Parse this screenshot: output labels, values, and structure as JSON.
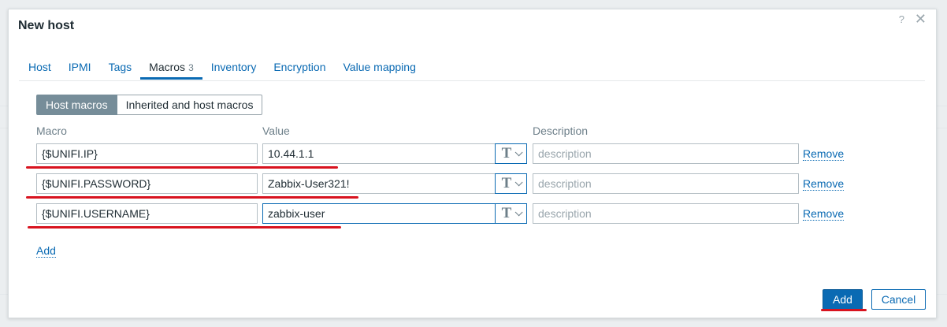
{
  "dialog": {
    "title": "New host",
    "help_icon": "?",
    "close_icon": "✕"
  },
  "tabs": [
    {
      "label": "Host"
    },
    {
      "label": "IPMI"
    },
    {
      "label": "Tags"
    },
    {
      "label": "Macros",
      "count": "3",
      "active": true
    },
    {
      "label": "Inventory"
    },
    {
      "label": "Encryption"
    },
    {
      "label": "Value mapping"
    }
  ],
  "macro_view": {
    "host_macros_label": "Host macros",
    "inherited_label": "Inherited and host macros"
  },
  "columns": {
    "macro": "Macro",
    "value": "Value",
    "description": "Description"
  },
  "macros": [
    {
      "macro": "{$UNIFI.IP}",
      "value": "10.44.1.1",
      "type_icon": "T",
      "description_placeholder": "description",
      "remove_label": "Remove"
    },
    {
      "macro": "{$UNIFI.PASSWORD}",
      "value": "Zabbix-User321!",
      "type_icon": "T",
      "description_placeholder": "description",
      "remove_label": "Remove"
    },
    {
      "macro": "{$UNIFI.USERNAME}",
      "value": "zabbix-user",
      "type_icon": "T",
      "description_placeholder": "description",
      "remove_label": "Remove"
    }
  ],
  "add_row_label": "Add",
  "footer": {
    "add_label": "Add",
    "cancel_label": "Cancel"
  },
  "colors": {
    "accent": "#0a6ab3",
    "annotation_red": "#d8131f",
    "segment_active": "#768d99"
  }
}
